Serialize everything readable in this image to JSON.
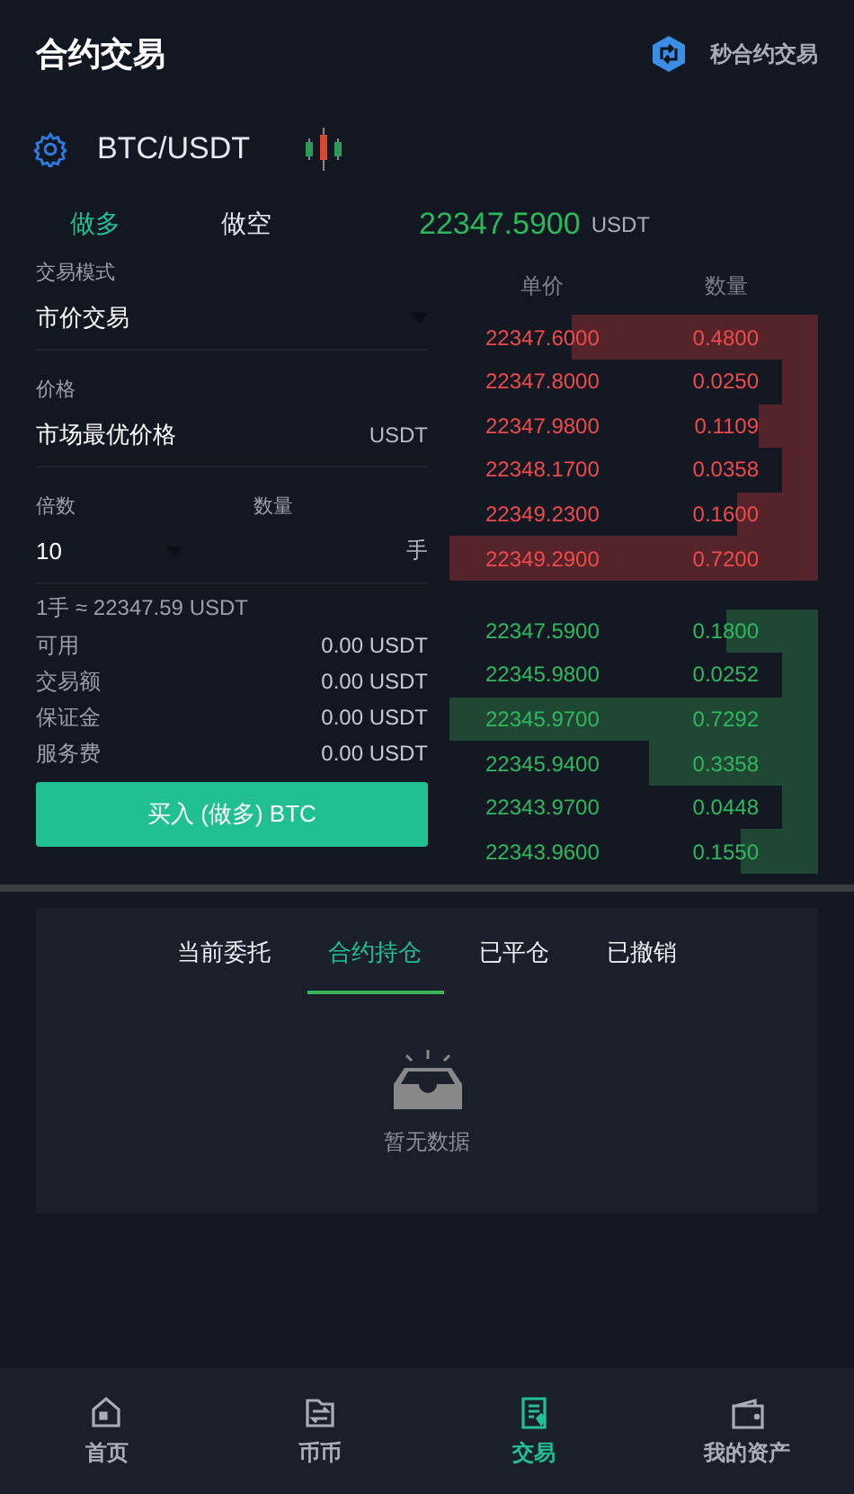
{
  "header": {
    "title": "合约交易",
    "link": "秒合约交易"
  },
  "pair": {
    "symbol": "BTC/USDT"
  },
  "sides": [
    {
      "label": "做多",
      "selected": true
    },
    {
      "label": "做空",
      "selected": false
    }
  ],
  "price": {
    "value": "22347.5900",
    "unit": "USDT"
  },
  "form": {
    "mode_label": "交易模式",
    "mode_value": "市价交易",
    "price_label": "价格",
    "price_value": "市场最优价格",
    "price_unit": "USDT",
    "leverage_label": "倍数",
    "amount_label": "数量",
    "leverage_value": "10",
    "amount_unit": "手",
    "lot_note": "1手 ≈ 22347.59 USDT",
    "stats": [
      {
        "label": "可用",
        "value": "0.00 USDT"
      },
      {
        "label": "交易额",
        "value": "0.00 USDT"
      },
      {
        "label": "保证金",
        "value": "0.00 USDT"
      },
      {
        "label": "服务费",
        "value": "0.00 USDT"
      }
    ],
    "submit": "买入 (做多) BTC"
  },
  "book": {
    "columns": [
      "单价",
      "数量"
    ],
    "asks": [
      {
        "price": "22347.6000",
        "amount": "0.4800",
        "level": 0.67
      },
      {
        "price": "22347.8000",
        "amount": "0.0250",
        "level": 0.1
      },
      {
        "price": "22347.9800",
        "amount": "0.1109",
        "level": 0.16
      },
      {
        "price": "22348.1700",
        "amount": "0.0358",
        "level": 0.1
      },
      {
        "price": "22349.2300",
        "amount": "0.1600",
        "level": 0.22
      },
      {
        "price": "22349.2900",
        "amount": "0.7200",
        "level": 1
      }
    ],
    "bids": [
      {
        "price": "22347.5900",
        "amount": "0.1800",
        "level": 0.25
      },
      {
        "price": "22345.9800",
        "amount": "0.0252",
        "level": 0.1
      },
      {
        "price": "22345.9700",
        "amount": "0.7292",
        "level": 1
      },
      {
        "price": "22345.9400",
        "amount": "0.3358",
        "level": 0.46
      },
      {
        "price": "22343.9700",
        "amount": "0.0448",
        "level": 0.1
      },
      {
        "price": "22343.9600",
        "amount": "0.1550",
        "level": 0.21
      }
    ]
  },
  "orders": {
    "tabs": [
      {
        "label": "当前委托",
        "selected": false
      },
      {
        "label": "合约持仓",
        "selected": true
      },
      {
        "label": "已平仓",
        "selected": false
      },
      {
        "label": "已撤销",
        "selected": false
      }
    ],
    "empty": "暂无数据"
  },
  "nav": [
    {
      "label": "首页",
      "kind": "home",
      "selected": false
    },
    {
      "label": "币币",
      "kind": "exchange",
      "selected": false
    },
    {
      "label": "交易",
      "kind": "trade",
      "selected": true
    },
    {
      "label": "我的资产",
      "kind": "wallet",
      "selected": false
    }
  ]
}
